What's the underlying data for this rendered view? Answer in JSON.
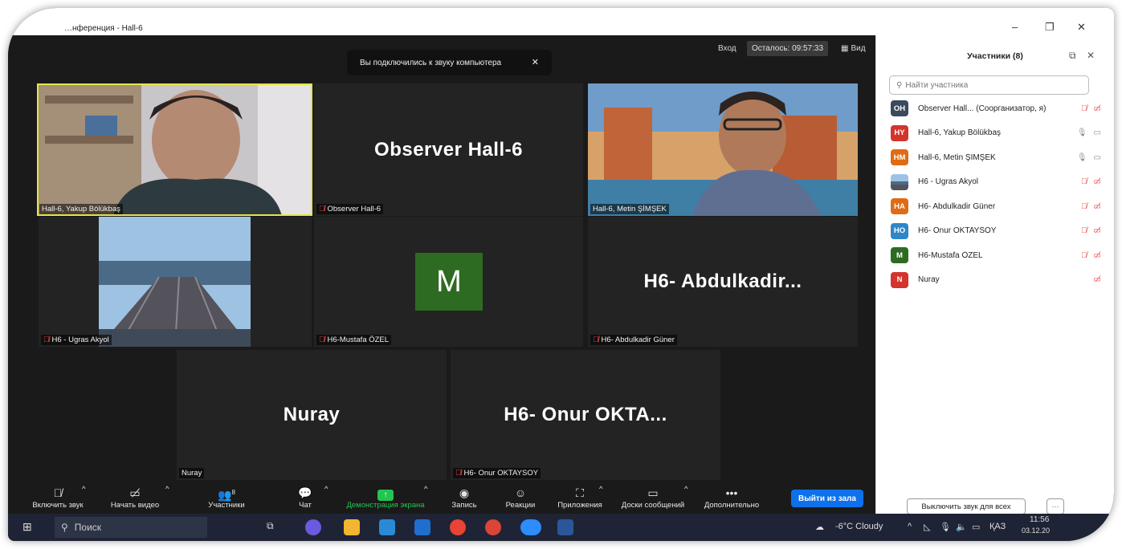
{
  "window": {
    "title": "…нференция - Hall-6",
    "controls": [
      "–",
      "❐",
      "✕"
    ]
  },
  "topbar": {
    "enter": "Вход",
    "timer": "Осталось: 09:57:33",
    "view": "Вид"
  },
  "toast": {
    "text": "Вы подключились к звуку компьютера",
    "close": "✕"
  },
  "tiles": [
    {
      "label": "Hall-6, Yakup Bölükbaş",
      "big": ""
    },
    {
      "label": "Observer  Hall-6",
      "big": "Observer  Hall-6"
    },
    {
      "label": "Hall-6, Metin ŞİMŞEK",
      "big": ""
    },
    {
      "label": "H6 - Ugras Akyol",
      "big": ""
    },
    {
      "label": "H6-Mustafa ÖZEL",
      "big": "M"
    },
    {
      "label": "H6- Abdulkadir Güner",
      "big": "H6-  Abdulkadir..."
    },
    {
      "label": "Nuray",
      "big": "Nuray"
    },
    {
      "label": "H6- Onur OKTAYSOY",
      "big": "H6-  Onur OKTA..."
    }
  ],
  "toolbar": {
    "audio": "Включить звук",
    "video": "Начать видео",
    "participants": "Участники",
    "participants_count": "8",
    "chat": "Чат",
    "share": "Демонстрация экрана",
    "record": "Запись",
    "reactions": "Реакции",
    "apps": "Приложения",
    "whiteboards": "Доски сообщений",
    "more": "Дополнительно",
    "leave": "Выйти из зала"
  },
  "panel": {
    "title": "Участники (8)",
    "search_placeholder": "Найти участника",
    "participants": [
      {
        "initials": "OH",
        "color": "#3b4a5c",
        "name": "Observer  Hall... (Соорганизатор, я)",
        "mic": "muted",
        "video": "off"
      },
      {
        "initials": "HY",
        "color": "#d4342b",
        "name": "Hall-6, Yakup Bölükbaş",
        "mic": "on",
        "video": "on"
      },
      {
        "initials": "HM",
        "color": "#e06b14",
        "name": "Hall-6, Metin ŞİMŞEK",
        "mic": "on",
        "video": "on"
      },
      {
        "initials": "",
        "color": "#4d6d8f",
        "name": "H6 - Ugras Akyol",
        "mic": "muted",
        "video": "off"
      },
      {
        "initials": "HA",
        "color": "#e06b14",
        "name": "H6- Abdulkadir Güner",
        "mic": "muted",
        "video": "off"
      },
      {
        "initials": "HO",
        "color": "#2f86c9",
        "name": "H6- Onur OKTAYSOY",
        "mic": "muted",
        "video": "off"
      },
      {
        "initials": "M",
        "color": "#2e6b22",
        "name": "H6-Mustafa ÖZEL",
        "mic": "muted",
        "video": "off"
      },
      {
        "initials": "N",
        "color": "#d4342b",
        "name": "Nuray",
        "mic": "none",
        "video": "off"
      }
    ],
    "mute_all": "Выключить звук для всех",
    "more": "···"
  },
  "taskbar": {
    "search": "Поиск",
    "weather": "-6°C  Cloudy",
    "lang": "ҚАЗ",
    "time": "11:56",
    "date": "03.12.20"
  }
}
